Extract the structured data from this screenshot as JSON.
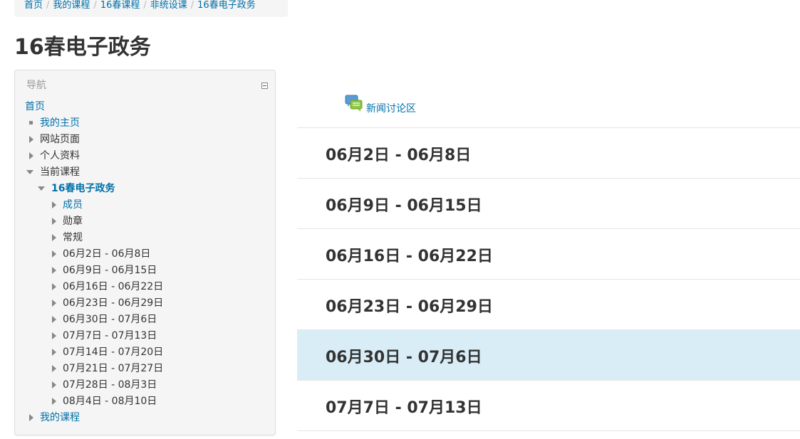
{
  "breadcrumb": [
    "首页",
    "我的课程",
    "16春课程",
    "非统设课",
    "16春电子政务"
  ],
  "page_title": "16春电子政务",
  "navigation": {
    "header": "导航",
    "home": "首页",
    "my_home": "我的主页",
    "site_pages": "网站页面",
    "profile": "个人资料",
    "current_course": "当前课程",
    "course_name": "16春电子政务",
    "course_children": [
      "成员",
      "勋章",
      "常规",
      "06月2日 - 06月8日",
      "06月9日 - 06月15日",
      "06月16日 - 06月22日",
      "06月23日 - 06月29日",
      "06月30日 - 07月6日",
      "07月7日 - 07月13日",
      "07月14日 - 07月20日",
      "07月21日 - 07月27日",
      "07月28日 - 08月3日",
      "08月4日 - 08月10日"
    ],
    "my_courses": "我的课程"
  },
  "news_forum": {
    "label": "新闻讨论区",
    "icon": "forum-icon"
  },
  "sections": [
    {
      "title": "06月2日 - 06月8日",
      "current": false
    },
    {
      "title": "06月9日 - 06月15日",
      "current": false
    },
    {
      "title": "06月16日 - 06月22日",
      "current": false
    },
    {
      "title": "06月23日 - 06月29日",
      "current": false
    },
    {
      "title": "06月30日 - 07月6日",
      "current": true
    },
    {
      "title": "07月7日 - 07月13日",
      "current": false
    }
  ],
  "colors": {
    "link": "#0070a8",
    "current_section": "#d9edf7",
    "block_bg": "#f5f5f5"
  }
}
